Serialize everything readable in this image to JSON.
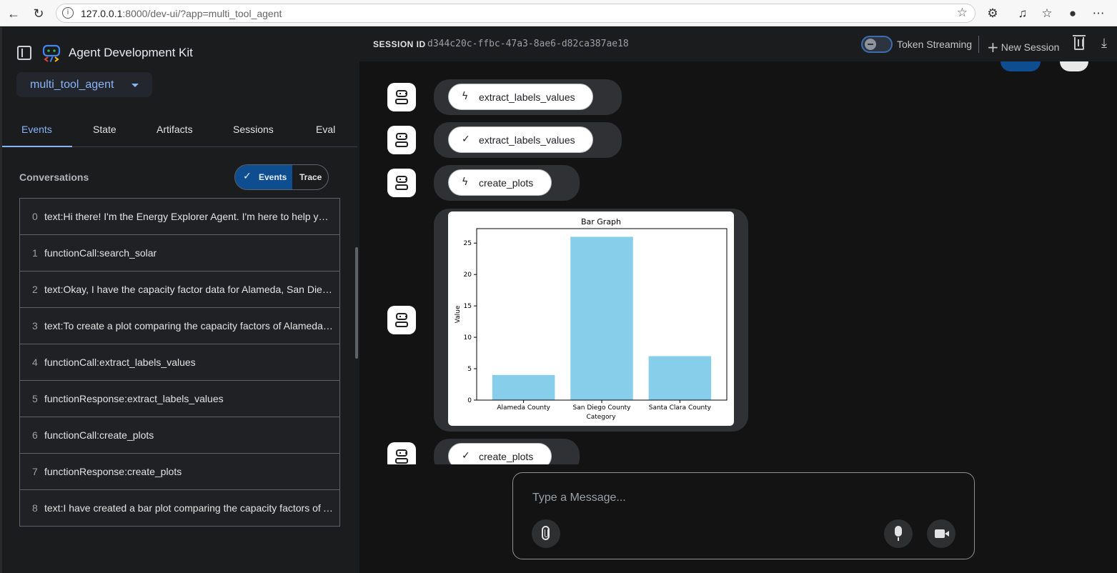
{
  "browser": {
    "url_host": "127.0.0.1",
    "url_rest": ":8000/dev-ui/?app=multi_tool_agent"
  },
  "app": {
    "title": "Agent Development Kit",
    "agent_name": "multi_tool_agent"
  },
  "tabs": [
    "Events",
    "State",
    "Artifacts",
    "Sessions",
    "Eval"
  ],
  "active_tab": "Events",
  "conversations": {
    "label": "Conversations",
    "toggle_events": "Events",
    "toggle_trace": "Trace",
    "events": [
      {
        "index": "0",
        "text": "text:Hi there! I'm the Energy Explorer Agent. I'm here to help you..."
      },
      {
        "index": "1",
        "text": "functionCall:search_solar"
      },
      {
        "index": "2",
        "text": "text:Okay, I have the capacity factor data for Alameda, San Diego, and Santa Clara..."
      },
      {
        "index": "3",
        "text": "text:To create a plot comparing the capacity factors of Alameda, San Diego..."
      },
      {
        "index": "4",
        "text": "functionCall:extract_labels_values"
      },
      {
        "index": "5",
        "text": "functionResponse:extract_labels_values"
      },
      {
        "index": "6",
        "text": "functionCall:create_plots"
      },
      {
        "index": "7",
        "text": "functionResponse:create_plots"
      },
      {
        "index": "8",
        "text": "text:I have created a bar plot comparing the capacity factors of Alameda..."
      }
    ]
  },
  "topbar": {
    "session_label": "SESSION ID",
    "session_id": "d344c20c-ffbc-47a3-8ae6-d82ca387ae18",
    "token_streaming": "Token Streaming",
    "new_session": "New Session"
  },
  "messages": [
    {
      "icon": "bolt-icon",
      "glyph": "ϟ",
      "label": "extract_labels_values"
    },
    {
      "icon": "check-icon",
      "glyph": "✓",
      "label": "extract_labels_values"
    },
    {
      "icon": "bolt-icon",
      "glyph": "ϟ",
      "label": "create_plots"
    },
    {
      "icon": "check-icon",
      "glyph": "✓",
      "label": "create_plots"
    }
  ],
  "chart_data": {
    "type": "bar",
    "title": "Bar Graph",
    "xlabel": "Category",
    "ylabel": "Value",
    "categories": [
      "Alameda County",
      "San Diego County",
      "Santa Clara County"
    ],
    "values": [
      4,
      26,
      7
    ],
    "ylim": [
      0,
      27.3
    ],
    "yticks": [
      0,
      5,
      10,
      15,
      20,
      25
    ],
    "bar_color": "#87ceeb"
  },
  "input": {
    "placeholder": "Type a Message..."
  },
  "colors": {
    "accent": "#8ab4f8",
    "toggle_active": "#0f4d91"
  }
}
